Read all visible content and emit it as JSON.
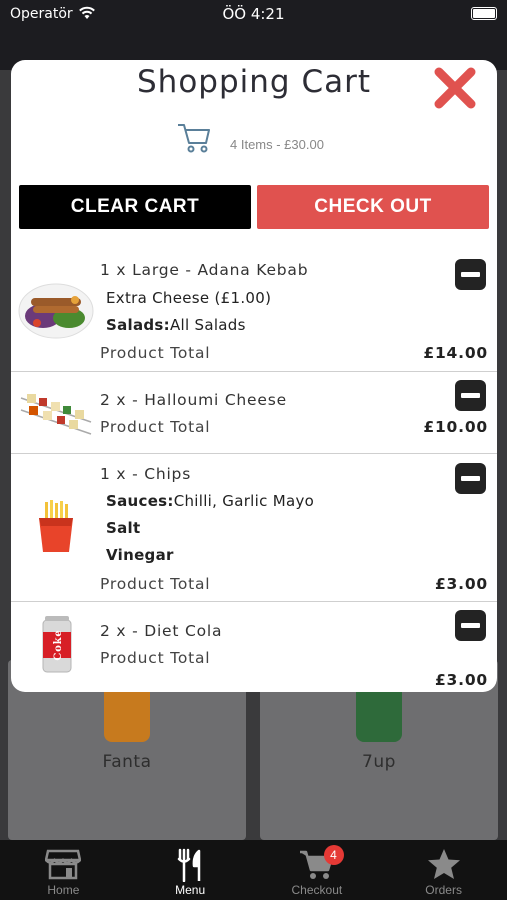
{
  "status_bar": {
    "carrier": "Operatör",
    "time": "ÖÖ 4:21"
  },
  "backdrop": {
    "products": [
      {
        "name": "Fanta"
      },
      {
        "name": "7up"
      }
    ]
  },
  "cart": {
    "title": "Shopping Cart",
    "summary": "4 Items - £30.00",
    "clear_label": "CLEAR CART",
    "checkout_label": "CHECK OUT",
    "total_label": "Product Total",
    "items": [
      {
        "title": "1 x Large - Adana Kebab",
        "extras": "Extra Cheese (£1.00)",
        "salads_key": "Salads:",
        "salads_value": "All Salads",
        "total": "£14.00",
        "image": "kebab-plate"
      },
      {
        "title": "2 x - Halloumi Cheese",
        "total": "£10.00",
        "image": "halloumi-skewers"
      },
      {
        "title": "1 x - Chips",
        "sauces_key": "Sauces:",
        "sauces_value": "Chilli, Garlic Mayo",
        "option1": "Salt",
        "option2": "Vinegar",
        "total": "£3.00",
        "image": "chips-box"
      },
      {
        "title": "2 x - Diet Cola",
        "total": "£3.00",
        "image": "diet-coke-can",
        "can_text": "Coke"
      }
    ]
  },
  "tabs": [
    {
      "label": "Home",
      "icon": "store-icon"
    },
    {
      "label": "Menu",
      "icon": "cutlery-icon"
    },
    {
      "label": "Checkout",
      "icon": "cart-icon",
      "badge": "4"
    },
    {
      "label": "Orders",
      "icon": "star-icon"
    }
  ],
  "colors": {
    "checkout_button": "#e0524f",
    "close_icon": "#e0524f",
    "badge": "#e53935",
    "tab_bar": "#121212"
  }
}
